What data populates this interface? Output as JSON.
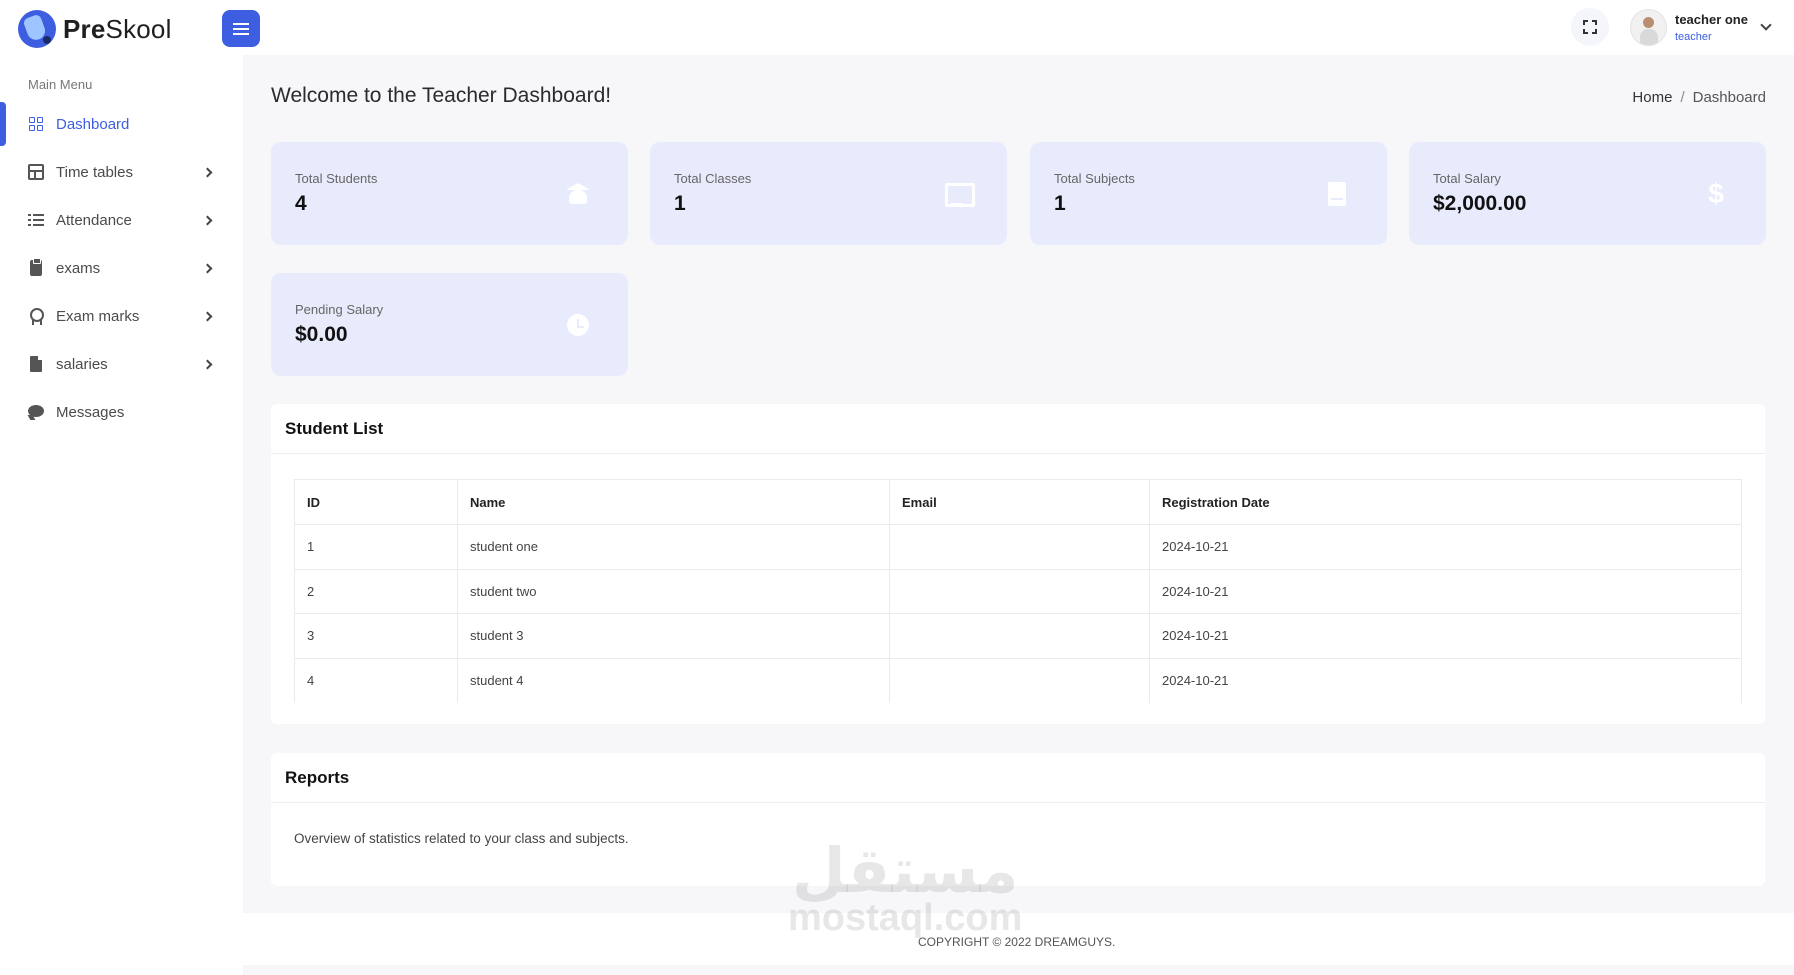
{
  "app": {
    "logo_bold": "Pre",
    "logo_rest": "Skool"
  },
  "header": {
    "user_name": "teacher one",
    "user_role": "teacher"
  },
  "sidebar": {
    "title": "Main Menu",
    "items": [
      {
        "label": "Dashboard",
        "icon": "grid-icon",
        "active": true
      },
      {
        "label": "Time tables",
        "icon": "table-icon"
      },
      {
        "label": "Attendance",
        "icon": "list-icon"
      },
      {
        "label": "exams",
        "icon": "clipboard-icon"
      },
      {
        "label": "Exam marks",
        "icon": "award-icon"
      },
      {
        "label": "salaries",
        "icon": "file-invoice-icon"
      },
      {
        "label": "Messages",
        "icon": "chat-icon"
      }
    ]
  },
  "page": {
    "title": "Welcome to the Teacher Dashboard!",
    "breadcrumb_home": "Home",
    "breadcrumb_sep": "/",
    "breadcrumb_current": "Dashboard"
  },
  "stats": [
    {
      "label": "Total Students",
      "value": "4",
      "icon": "graduate-icon"
    },
    {
      "label": "Total Classes",
      "value": "1",
      "icon": "chalkboard-icon"
    },
    {
      "label": "Total Subjects",
      "value": "1",
      "icon": "book-icon"
    },
    {
      "label": "Total Salary",
      "value": "$2,000.00",
      "icon": "dollar-icon"
    },
    {
      "label": "Pending Salary",
      "value": "$0.00",
      "icon": "clock-icon"
    }
  ],
  "student_list": {
    "title": "Student List",
    "columns": [
      "ID",
      "Name",
      "Email",
      "Registration Date"
    ],
    "rows": [
      [
        "1",
        "student one",
        "",
        "2024-10-21"
      ],
      [
        "2",
        "student two",
        "",
        "2024-10-21"
      ],
      [
        "3",
        "student 3",
        "",
        "2024-10-21"
      ],
      [
        "4",
        "student 4",
        "",
        "2024-10-21"
      ]
    ]
  },
  "reports": {
    "title": "Reports",
    "text": "Overview of statistics related to your class and subjects."
  },
  "footer": {
    "copyright": "COPYRIGHT © 2022 DREAMGUYS."
  },
  "watermark": {
    "arabic": "مستقل",
    "latin": "mostaql.com"
  },
  "colors": {
    "accent": "#3d5ee1",
    "stat_bg": "#e8ebfb",
    "page_bg": "#f7f7fa"
  }
}
